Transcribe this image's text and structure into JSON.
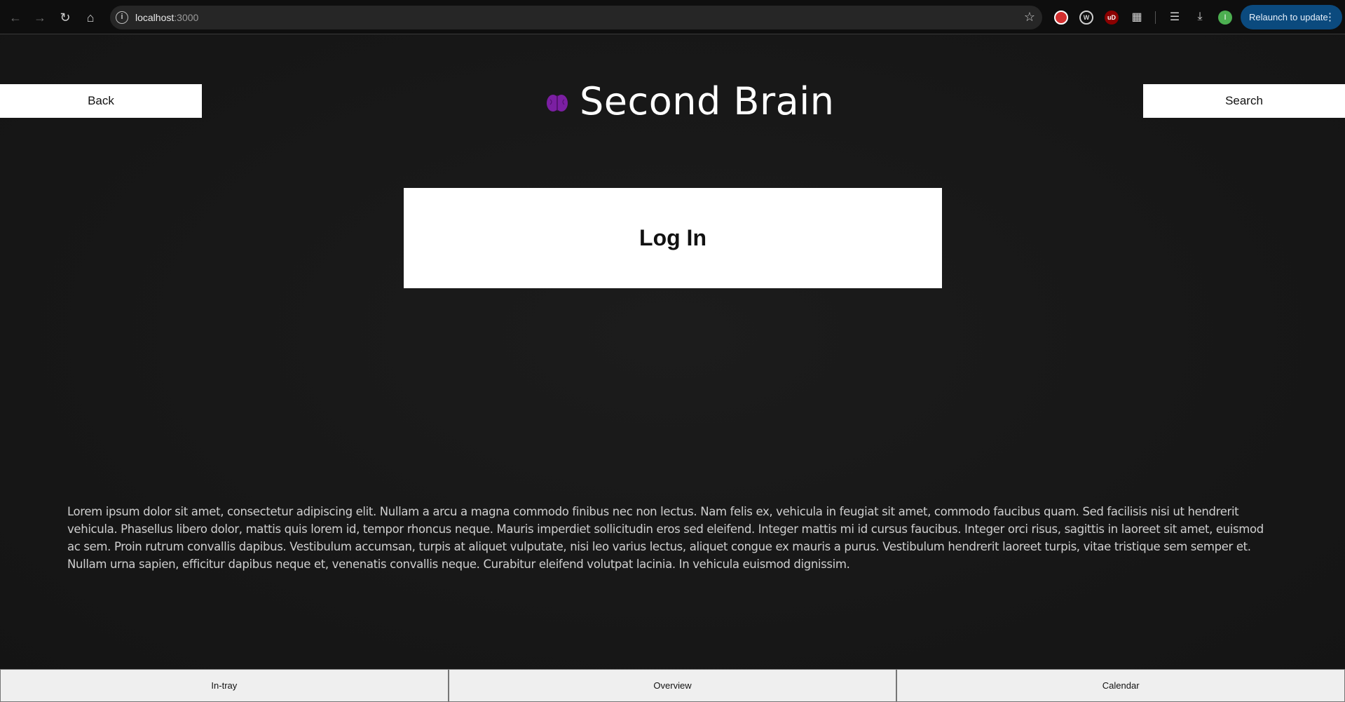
{
  "browser": {
    "url_host": "localhost",
    "url_port": ":3000",
    "relaunch_label": "Relaunch to update",
    "profile_initial": "I",
    "ext_badge_label": "uD"
  },
  "header": {
    "back_label": "Back",
    "search_label": "Search",
    "app_title": "Second Brain",
    "brand_color": "#7b1fa2"
  },
  "main": {
    "login_label": "Log In",
    "body_text": "Lorem ipsum dolor sit amet, consectetur adipiscing elit. Nullam a arcu a magna commodo finibus nec non lectus. Nam felis ex, vehicula in feugiat sit amet, commodo faucibus quam. Sed facilisis nisi ut hendrerit vehicula. Phasellus libero dolor, mattis quis lorem id, tempor rhoncus neque. Mauris imperdiet sollicitudin eros sed eleifend. Integer mattis mi id cursus faucibus. Integer orci risus, sagittis in laoreet sit amet, euismod ac sem. Proin rutrum convallis dapibus. Vestibulum accumsan, turpis at aliquet vulputate, nisi leo varius lectus, aliquet congue ex mauris a purus. Vestibulum hendrerit laoreet turpis, vitae tristique sem semper et. Nullam urna sapien, efficitur dapibus neque et, venenatis convallis neque. Curabitur eleifend volutpat lacinia. In vehicula euismod dignissim."
  },
  "footer": {
    "tabs": [
      {
        "label": "In-tray"
      },
      {
        "label": "Overview"
      },
      {
        "label": "Calendar"
      }
    ]
  }
}
